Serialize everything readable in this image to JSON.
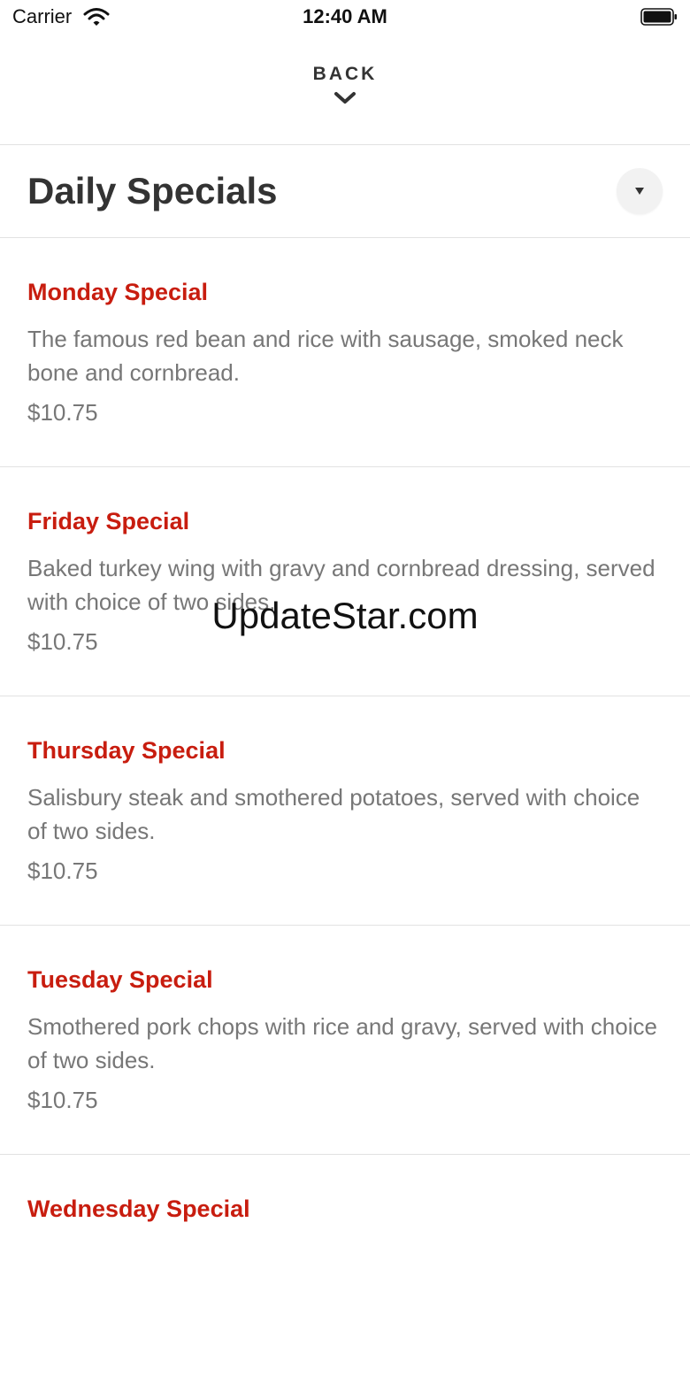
{
  "status_bar": {
    "carrier": "Carrier",
    "time": "12:40 AM"
  },
  "nav": {
    "back_label": "BACK"
  },
  "section": {
    "title": "Daily Specials"
  },
  "menu_items": [
    {
      "name": "Monday Special",
      "description": "The famous red bean and rice with sausage, smoked neck bone and cornbread.",
      "price": "$10.75"
    },
    {
      "name": "Friday Special",
      "description": "Baked turkey wing with gravy and cornbread dressing, served with choice of two sides.",
      "price": "$10.75"
    },
    {
      "name": "Thursday Special",
      "description": "Salisbury steak and smothered potatoes, served with choice of two sides.",
      "price": "$10.75"
    },
    {
      "name": "Tuesday Special",
      "description": "Smothered pork chops with rice and gravy, served with choice of two sides.",
      "price": "$10.75"
    },
    {
      "name": "Wednesday Special",
      "description": "",
      "price": ""
    }
  ],
  "watermark": "UpdateStar.com",
  "colors": {
    "accent": "#c81d0f",
    "text_primary": "#333333",
    "text_secondary": "#777777",
    "divider": "#e2e2e2"
  },
  "icons": {
    "wifi": "wifi-icon",
    "battery": "battery-icon",
    "back_chevron": "chevron-down-icon",
    "collapse": "triangle-down-icon"
  }
}
